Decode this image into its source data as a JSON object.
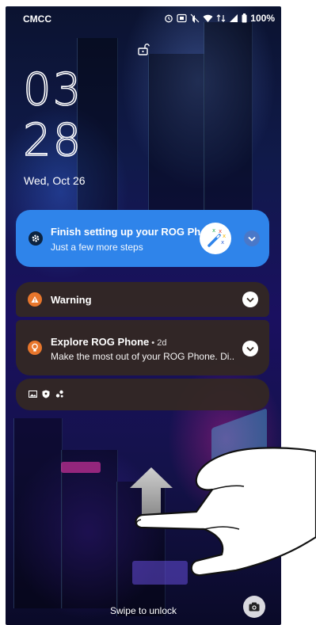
{
  "status_bar": {
    "carrier": "CMCC",
    "battery": "100%",
    "icons": [
      "alarm-icon",
      "nfc-icon",
      "mute-icon",
      "wifi-icon",
      "data-icon",
      "signal-icon",
      "battery-icon"
    ]
  },
  "lock_screen": {
    "hour": "03",
    "minute": "28",
    "date": "Wed, Oct 26"
  },
  "notifications": [
    {
      "title": "Finish setting up your ROG Pho..",
      "text": "Just a few more steps",
      "icon": "gear-icon",
      "thumbnail": "magic-wand-icon"
    },
    {
      "title": "Warning",
      "icon": "warning-icon"
    },
    {
      "title": "Explore ROG Phone",
      "meta": " • 2d",
      "text": "Make the most out of your ROG Phone. Di..",
      "icon": "lightbulb-icon"
    }
  ],
  "collapsed_icons": [
    "image-icon",
    "shield-icon",
    "apps-icon"
  ],
  "bottom": {
    "swipe_hint": "Swipe to unlock",
    "camera": "camera-icon"
  },
  "colors": {
    "accent_blue": "#2f84ea",
    "card_dark": "#342822",
    "warning_orange": "#e8762c"
  }
}
